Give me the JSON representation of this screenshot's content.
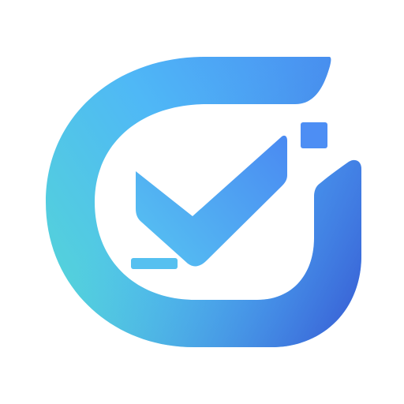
{
  "logo": {
    "icon": "checkmark-badge-icon",
    "colors": {
      "gradient_start": "#52d0dc",
      "gradient_mid": "#4fb6f6",
      "gradient_end": "#3a63d8",
      "check_start": "#55c2f2",
      "check_end": "#4a8cf2",
      "square": "#4d8ef4",
      "background": "#ffffff"
    }
  }
}
